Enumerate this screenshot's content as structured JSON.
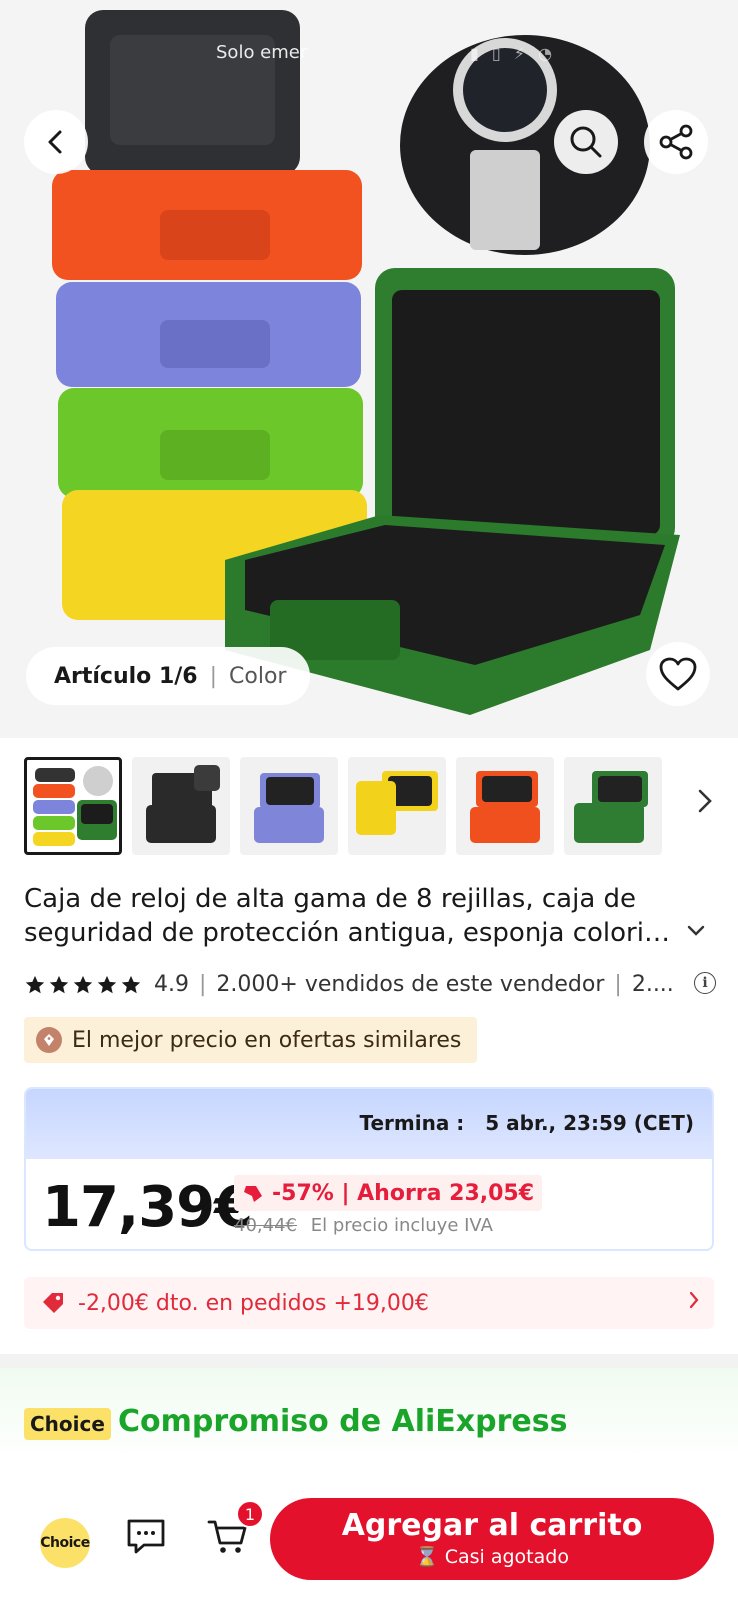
{
  "status_bar": {
    "network_text": "Solo emer"
  },
  "hero": {
    "article_label": "Artículo 1/6",
    "variant_label": "Color"
  },
  "icons": {
    "back": "chevron-left-icon",
    "search": "search-icon",
    "share": "share-icon",
    "wishlist": "heart-icon"
  },
  "thumbnails": [
    {
      "color": "#3c3c3c",
      "label": "multicolor"
    },
    {
      "color": "#2a2a2a",
      "label": "black"
    },
    {
      "color": "#7f86d9",
      "label": "purple"
    },
    {
      "color": "#f2d21a",
      "label": "yellow"
    },
    {
      "color": "#f0501e",
      "label": "orange"
    },
    {
      "color": "#2e7d32",
      "label": "green"
    }
  ],
  "product": {
    "title_line1": "Caja de reloj de alta gama de 8 rejillas, caja de",
    "title_line2": "seguridad de protección antigua, esponja colorida...",
    "rating": "4.9",
    "sold": "2.000+ vendidos de este vendedor",
    "sold_more": "2...."
  },
  "best_price_badge": "El mejor precio en ofertas similares",
  "price": {
    "ends_label": "Termina :",
    "ends_value": "5 abr., 23:59 (CET)",
    "current": "17,39€",
    "discount": "-57% | Ahorra 23,05€",
    "original": "40,44€",
    "vat_note": "El precio incluye IVA"
  },
  "coupon": {
    "text": "-2,00€ dto. en pedidos +19,00€"
  },
  "choice": {
    "badge": "Choice",
    "commitment": "Compromiso de AliExpress"
  },
  "bottom_bar": {
    "choice_label": "Choice",
    "cart_count": "1",
    "add_to_cart": "Agregar al carrito",
    "stock_note": "⌛ Casi agotado"
  },
  "colors": {
    "accent_red": "#e3112c",
    "choice_yellow": "#fce169",
    "choice_green": "#1aa52a"
  }
}
